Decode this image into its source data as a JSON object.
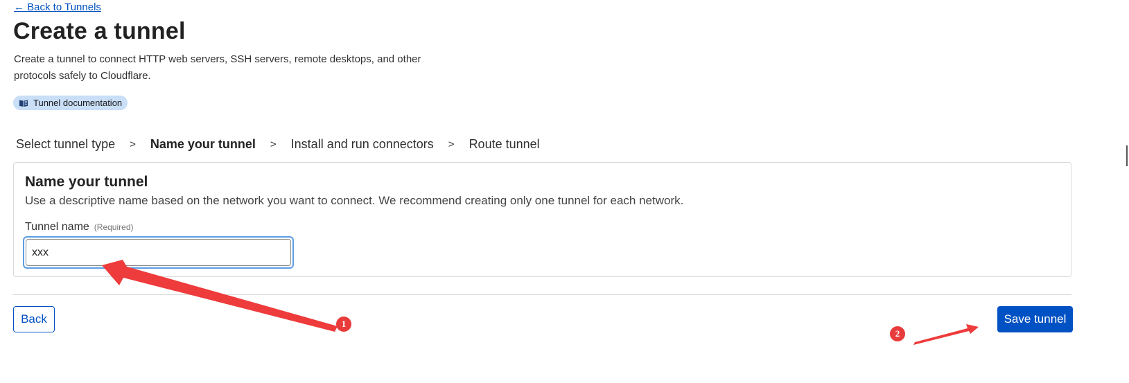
{
  "nav": {
    "back_link": "← Back to Tunnels"
  },
  "header": {
    "title": "Create a tunnel",
    "description": "Create a tunnel to connect HTTP web servers, SSH servers, remote desktops, and other protocols safely to Cloudflare.",
    "doc_pill": {
      "label": "Tunnel documentation",
      "icon": "book-icon"
    }
  },
  "steps": [
    {
      "label": "Select tunnel type",
      "active": false
    },
    {
      "label": "Name your tunnel",
      "active": true
    },
    {
      "label": "Install and run connectors",
      "active": false
    },
    {
      "label": "Route tunnel",
      "active": false
    }
  ],
  "step_separator": ">",
  "card": {
    "title": "Name your tunnel",
    "description": "Use a descriptive name based on the network you want to connect. We recommend creating only one tunnel for each network.",
    "field": {
      "label": "Tunnel name",
      "required_label": "(Required)",
      "value": "xxx"
    }
  },
  "footer": {
    "back_button": "Back",
    "save_button": "Save tunnel"
  },
  "annotations": {
    "badge_1": "1",
    "badge_2": "2"
  },
  "colors": {
    "accent": "#0051c3",
    "pill_bg": "#c9def7",
    "annotation_red": "#e83b3b",
    "focus_ring": "#5b9de4"
  }
}
